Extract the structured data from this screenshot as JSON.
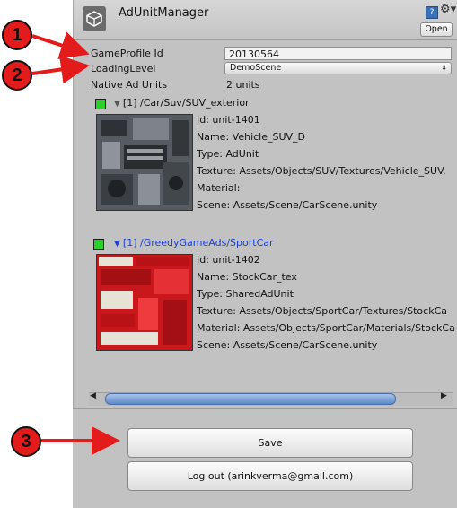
{
  "window": {
    "title": "AdUnitManager",
    "open_label": "Open",
    "help_glyph": "?",
    "settings_glyph": "⚙▾"
  },
  "profile": {
    "label": "GameProfile Id",
    "value": "20130564"
  },
  "loading": {
    "label": "LoadingLevel",
    "value": "DemoScene"
  },
  "native": {
    "label": "Native Ad Units",
    "value": "2 units"
  },
  "units": [
    {
      "path": "[1] /Car/Suv/SUV_exterior",
      "path_color": "#111111",
      "id": "Id: unit-1401",
      "name": "Name: Vehicle_SUV_D",
      "type": "Type: AdUnit",
      "texture": "Texture: Assets/Objects/SUV/Textures/Vehicle_SUV.",
      "material": "Material:",
      "scene": "Scene: Assets/Scene/CarScene.unity"
    },
    {
      "path": "[1] /GreedyGameAds/SportCar",
      "path_color": "#1c3fd6",
      "id": "Id: unit-1402",
      "name": "Name: StockCar_tex",
      "type": "Type: SharedAdUnit",
      "texture": "Texture: Assets/Objects/SportCar/Textures/StockCa",
      "material": "Material: Assets/Objects/SportCar/Materials/StockCa",
      "scene": "Scene: Assets/Scene/CarScene.unity"
    }
  ],
  "buttons": {
    "save": "Save",
    "logout": "Log out (arinkverma@gmail.com)"
  },
  "callouts": [
    "1",
    "2",
    "3"
  ],
  "colors": {
    "callout_red": "#e31b1b",
    "checkbox_green": "#2bd12b",
    "scroll_blue": "#5d88c9"
  }
}
